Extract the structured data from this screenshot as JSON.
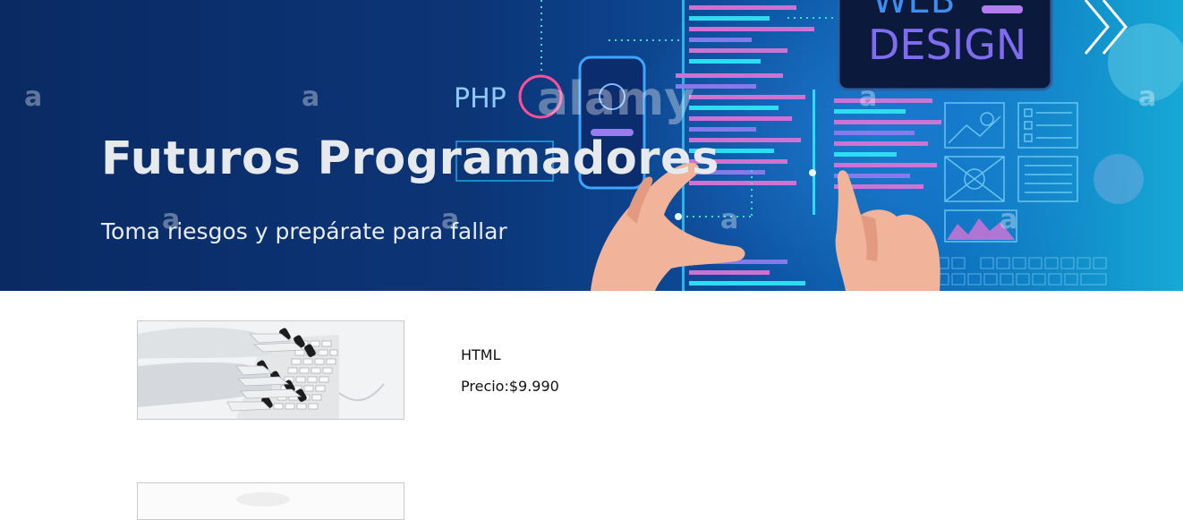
{
  "hero": {
    "title": "Futuros Programadores",
    "subtitle": "Toma riesgos y prepárate para fallar",
    "art_labels": {
      "php": "PHP",
      "web": "WEB",
      "design": "DESIGN",
      "watermark": "alamy",
      "watermark_letter": "a"
    }
  },
  "products": [
    {
      "name": "HTML",
      "price_label": "Precio:",
      "price_value": "$9.990"
    }
  ],
  "colors": {
    "hero_dark": "#0a2a63",
    "hero_light": "#16a9d6",
    "code_pink": "#d874d6",
    "code_cyan": "#31e3f5",
    "text_light": "#e6e9ee"
  }
}
